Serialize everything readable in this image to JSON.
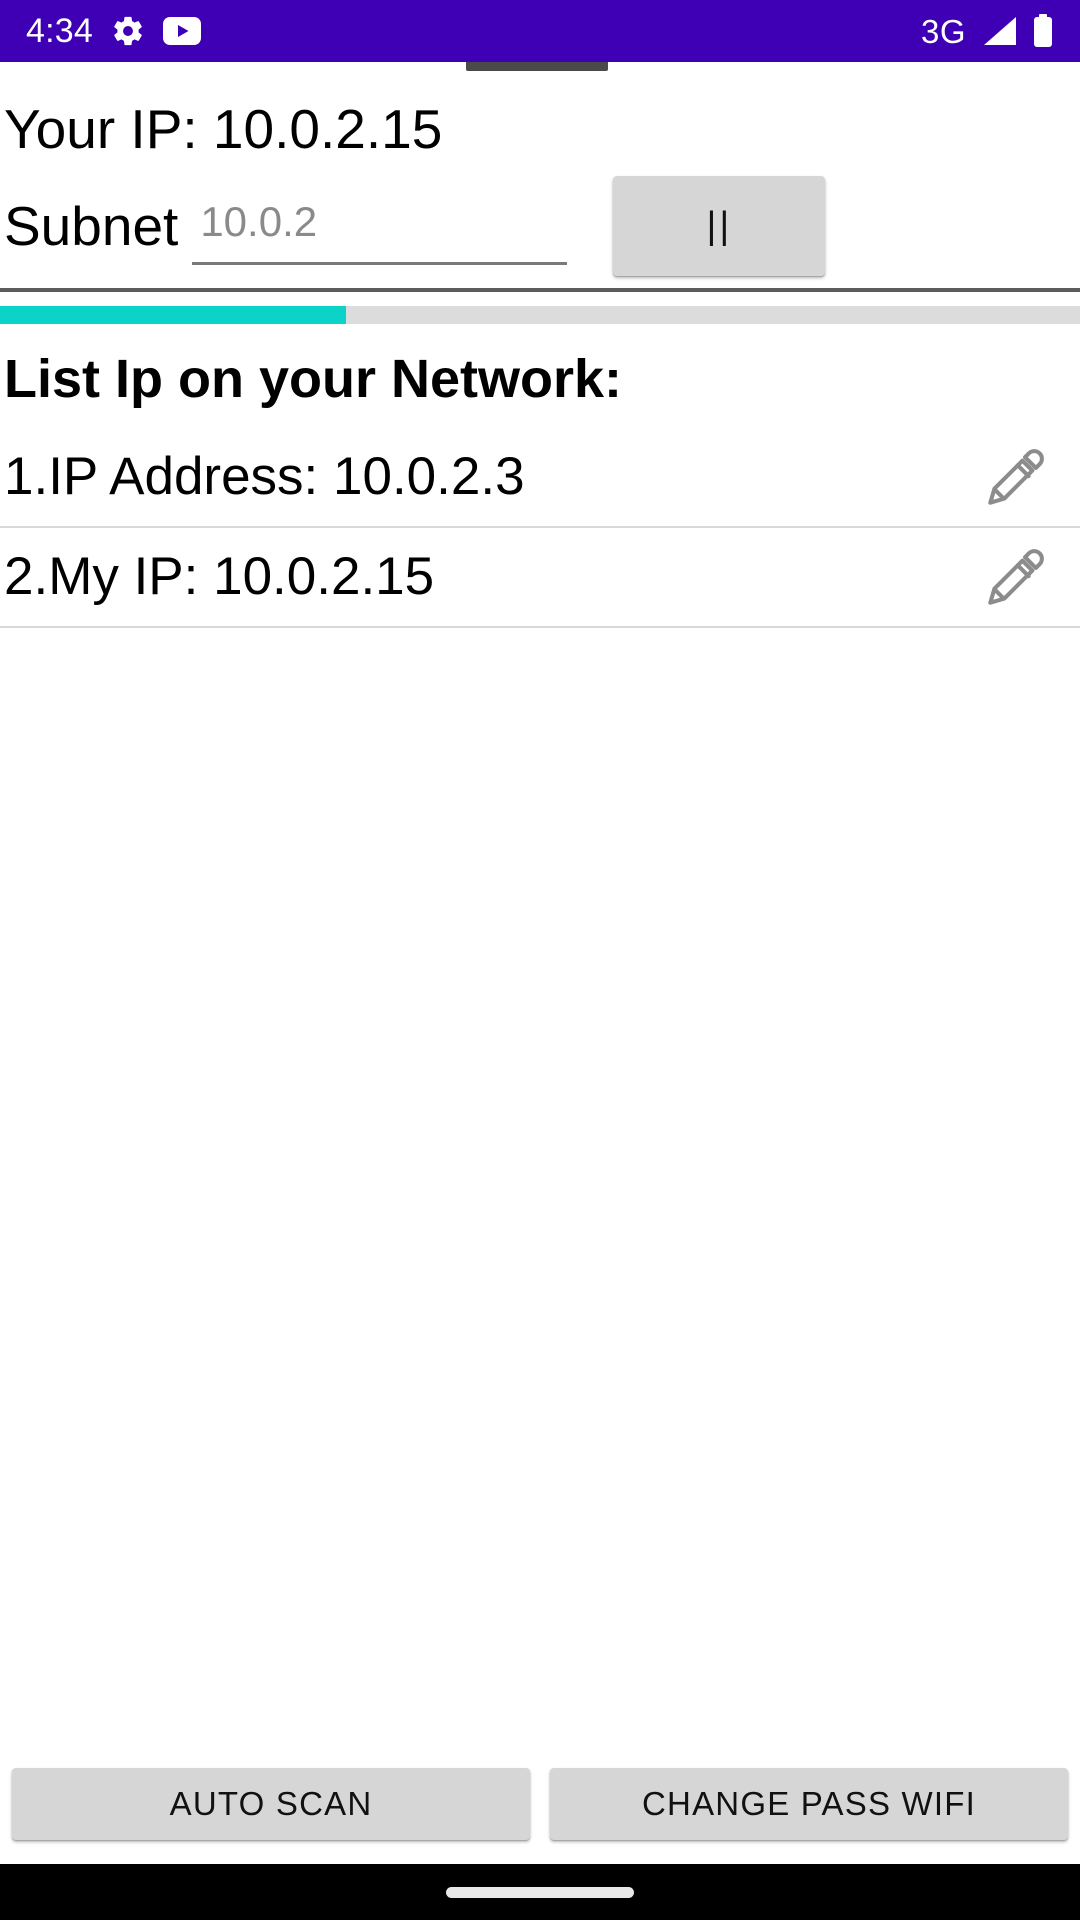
{
  "status_bar": {
    "clock": "4:34",
    "network_type": "3G",
    "background_color": "#3F00B5",
    "foreground_color": "#FFFFFF",
    "left_icons": [
      "settings-gear-icon",
      "youtube-icon"
    ],
    "right_icons": [
      "signal-triangle-icon",
      "battery-full-icon"
    ]
  },
  "app": {
    "your_ip_line": "Your IP: 10.0.2.15",
    "subnet": {
      "label": "Subnet",
      "value": "",
      "placeholder": "10.0.2"
    },
    "pause_button_label": "||",
    "progress": {
      "percent": 32,
      "fill_color": "#0BD3C8",
      "track_color": "#DCDCDC"
    },
    "list_heading": "List Ip on your Network:",
    "ip_rows": [
      {
        "text": "1.IP Address: 10.0.2.3",
        "edit_icon": "pencil-icon"
      },
      {
        "text": "2.My IP: 10.0.2.15",
        "edit_icon": "pencil-icon"
      }
    ],
    "bottom_buttons": [
      {
        "label": "AUTO SCAN"
      },
      {
        "label": "CHANGE PASS WIFI"
      }
    ]
  }
}
